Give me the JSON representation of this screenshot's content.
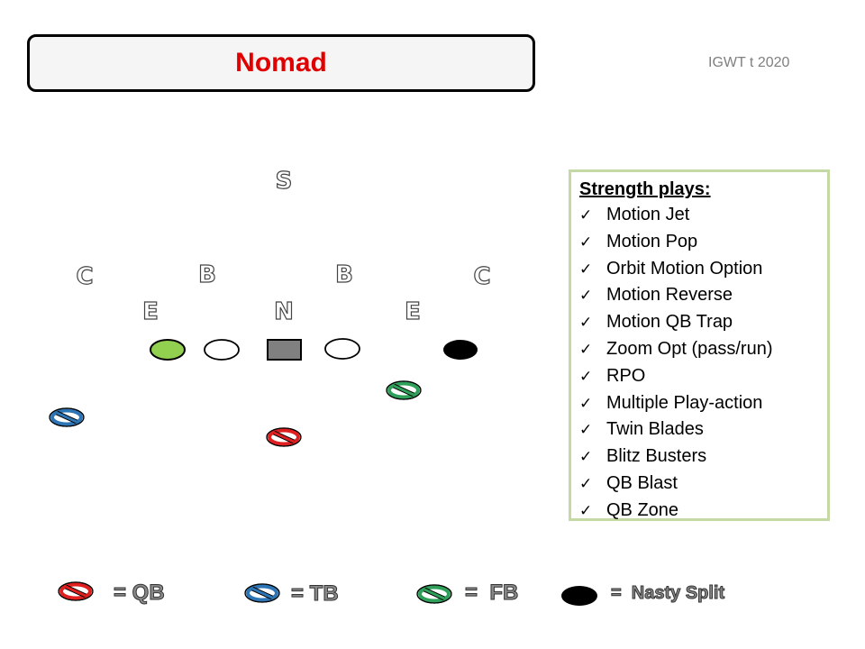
{
  "header": {
    "title": "Nomad",
    "credit": "IGWT t 2020"
  },
  "defense": [
    {
      "id": "safety",
      "label": "S"
    },
    {
      "id": "corner-left",
      "label": "C"
    },
    {
      "id": "backer-left",
      "label": "B"
    },
    {
      "id": "backer-right",
      "label": "B"
    },
    {
      "id": "corner-right",
      "label": "C"
    },
    {
      "id": "end-left",
      "label": "E"
    },
    {
      "id": "nose",
      "label": "N"
    },
    {
      "id": "end-right",
      "label": "E"
    }
  ],
  "offense": {
    "line": [
      {
        "id": "tackle-left",
        "shape": "ellipse",
        "fill": "#92d050"
      },
      {
        "id": "guard-left",
        "shape": "ellipse",
        "fill": "#ffffff"
      },
      {
        "id": "center",
        "shape": "rect",
        "fill": "#808080"
      },
      {
        "id": "guard-right",
        "shape": "ellipse",
        "fill": "#ffffff"
      },
      {
        "id": "nasty-split",
        "shape": "ellipse",
        "fill": "#000000"
      }
    ],
    "backs": [
      {
        "id": "qb",
        "role": "QB",
        "color": "#e02020"
      },
      {
        "id": "tb",
        "role": "TB",
        "color": "#2e75b6"
      },
      {
        "id": "fb",
        "role": "FB",
        "color": "#2ea05a"
      }
    ]
  },
  "plays": {
    "title": "Strength plays:",
    "check_icon": "✓",
    "items": [
      "Motion Jet",
      "Motion Pop",
      "Orbit Motion Option",
      "Motion Reverse",
      "Motion QB Trap",
      "Zoom Opt (pass/run)",
      "RPO",
      "Multiple Play-action",
      "Twin Blades",
      "Blitz Busters",
      "QB Blast",
      "QB Zone"
    ]
  },
  "legend": [
    {
      "icon": "qb-symbol-icon",
      "label": "= QB",
      "color": "#e02020"
    },
    {
      "icon": "tb-symbol-icon",
      "label": "= TB",
      "color": "#2e75b6"
    },
    {
      "icon": "fb-symbol-icon",
      "label": "=  FB",
      "color": "#2ea05a"
    },
    {
      "icon": "nasty-split-icon",
      "label": "=  Nasty Split",
      "color": "#000000"
    }
  ]
}
